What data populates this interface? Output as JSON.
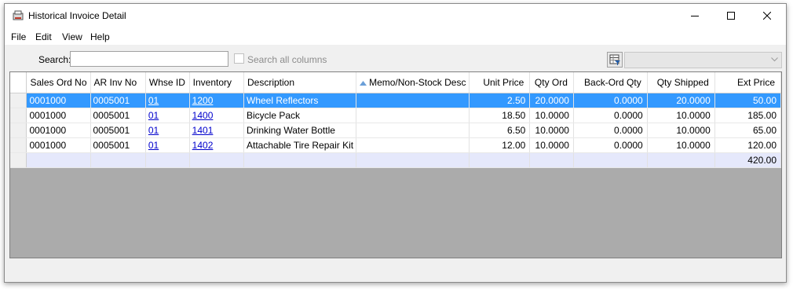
{
  "window": {
    "title": "Historical Invoice Detail"
  },
  "menu": [
    "File",
    "Edit",
    "View",
    "Help"
  ],
  "search": {
    "label": "Search:",
    "value": "",
    "search_all_label": "Search all columns",
    "search_all_checked": false
  },
  "grid": {
    "columns": [
      {
        "label": "Sales Ord No",
        "align": "left"
      },
      {
        "label": "AR Inv No",
        "align": "left"
      },
      {
        "label": "Whse ID",
        "align": "left"
      },
      {
        "label": "Inventory",
        "align": "left"
      },
      {
        "label": "Description",
        "align": "left"
      },
      {
        "label": "Memo/Non-Stock Desc",
        "align": "left",
        "sort": "ascending"
      },
      {
        "label": "Unit Price",
        "align": "right"
      },
      {
        "label": "Qty Ord",
        "align": "right"
      },
      {
        "label": "Back-Ord Qty",
        "align": "right"
      },
      {
        "label": "Qty Shipped",
        "align": "right"
      },
      {
        "label": "Ext Price",
        "align": "right"
      }
    ],
    "rows": [
      {
        "sales_ord_no": "0001000",
        "ar_inv_no": "0005001",
        "whse_id": "01",
        "inventory": "1200",
        "description": "Wheel Reflectors",
        "memo": "",
        "unit_price": "2.50",
        "qty_ord": "20.0000",
        "back_ord_qty": "0.0000",
        "qty_shipped": "20.0000",
        "ext_price": "50.00",
        "selected": true
      },
      {
        "sales_ord_no": "0001000",
        "ar_inv_no": "0005001",
        "whse_id": "01",
        "inventory": "1400",
        "description": "Bicycle Pack",
        "memo": "",
        "unit_price": "18.50",
        "qty_ord": "10.0000",
        "back_ord_qty": "0.0000",
        "qty_shipped": "10.0000",
        "ext_price": "185.00",
        "selected": false
      },
      {
        "sales_ord_no": "0001000",
        "ar_inv_no": "0005001",
        "whse_id": "01",
        "inventory": "1401",
        "description": "Drinking Water Bottle",
        "memo": "",
        "unit_price": "6.50",
        "qty_ord": "10.0000",
        "back_ord_qty": "0.0000",
        "qty_shipped": "10.0000",
        "ext_price": "65.00",
        "selected": false
      },
      {
        "sales_ord_no": "0001000",
        "ar_inv_no": "0005001",
        "whse_id": "01",
        "inventory": "1402",
        "description": "Attachable Tire Repair Kit",
        "memo": "",
        "unit_price": "12.00",
        "qty_ord": "10.0000",
        "back_ord_qty": "0.0000",
        "qty_shipped": "10.0000",
        "ext_price": "120.00",
        "selected": false
      }
    ],
    "total": {
      "ext_price": "420.00"
    }
  },
  "colors": {
    "selection": "#3399ff",
    "total_row": "#e5e8fb",
    "link": "#0000cc",
    "grid_background": "#ababab"
  },
  "icons": {
    "app": "app-icon",
    "minimize": "minimize-icon",
    "maximize": "maximize-icon",
    "close": "close-icon",
    "filter": "filter-icon",
    "dropdown": "chevron-down-icon",
    "sort": "sort-ascending-icon"
  }
}
